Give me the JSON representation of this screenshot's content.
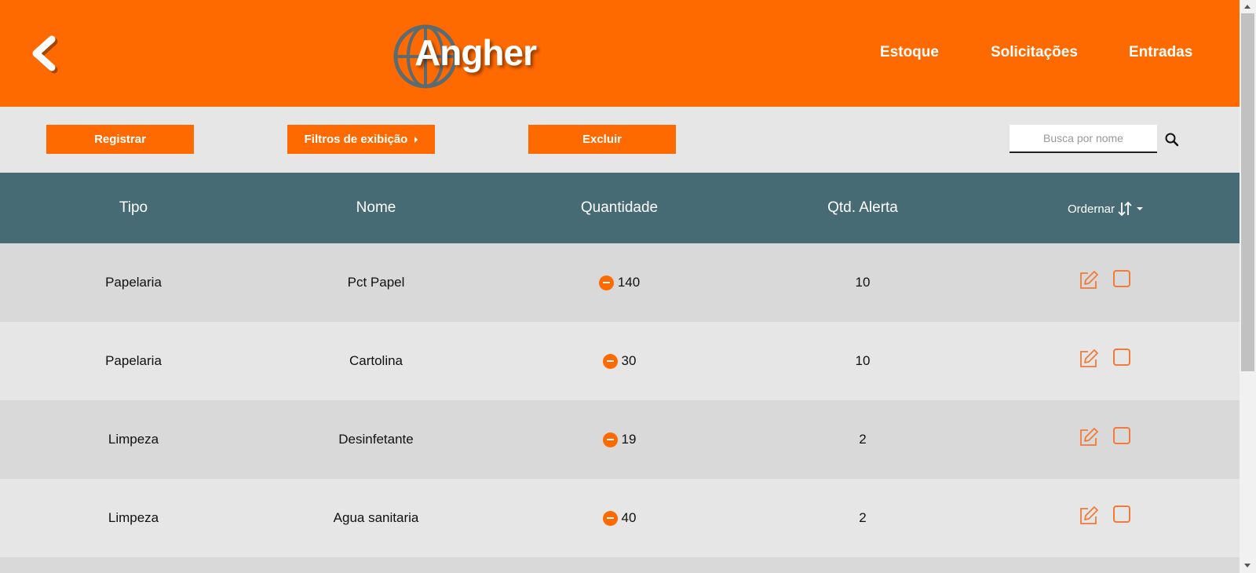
{
  "header": {
    "logo_text": "Angher",
    "nav": [
      "Estoque",
      "Solicitações",
      "Entradas"
    ]
  },
  "toolbar": {
    "register_label": "Registrar",
    "filters_label": "Filtros de exibição",
    "delete_label": "Excluir",
    "search_placeholder": "Busca por nome"
  },
  "table": {
    "columns": [
      "Tipo",
      "Nome",
      "Quantidade",
      "Qtd. Alerta"
    ],
    "sort_label": "Ordernar",
    "rows": [
      {
        "tipo": "Papelaria",
        "nome": "Pct Papel",
        "quantidade": "140",
        "alerta": "10"
      },
      {
        "tipo": "Papelaria",
        "nome": "Cartolina",
        "quantidade": "30",
        "alerta": "10"
      },
      {
        "tipo": "Limpeza",
        "nome": "Desinfetante",
        "quantidade": "19",
        "alerta": "2"
      },
      {
        "tipo": "Limpeza",
        "nome": "Agua sanitaria",
        "quantidade": "40",
        "alerta": "2"
      }
    ]
  },
  "colors": {
    "accent": "#ff6a00",
    "table_header": "#476b75",
    "row_odd": "#d9d9d9",
    "row_even": "#e6e6e6"
  },
  "icons": [
    "back-arrow-icon",
    "search-icon",
    "sort-arrows-icon",
    "edit-icon",
    "minus-circle-icon",
    "checkbox"
  ]
}
